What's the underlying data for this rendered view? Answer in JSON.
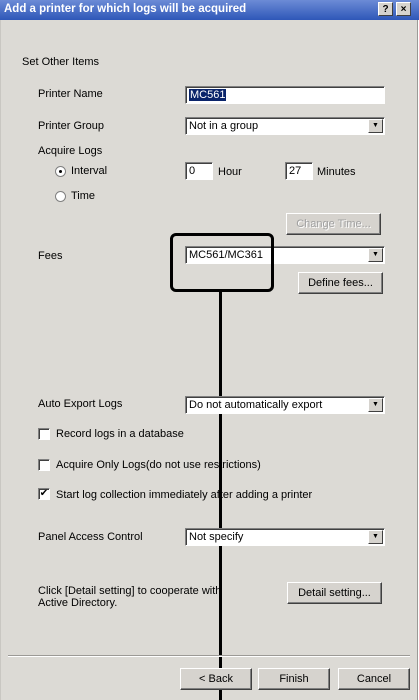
{
  "window": {
    "title": "Add a printer for which logs will be acquired",
    "help_label": "?",
    "close_label": "×"
  },
  "section_title": "Set Other Items",
  "printer_name": {
    "label": "Printer Name",
    "value": "MC561"
  },
  "printer_group": {
    "label": "Printer Group",
    "value": "Not in a group"
  },
  "acquire_logs": {
    "label": "Acquire Logs",
    "interval_label": "Interval",
    "time_label": "Time",
    "selected": "Interval",
    "hour_value": "0",
    "hour_label": "Hour",
    "minutes_value": "27",
    "minutes_label": "Minutes",
    "change_time_label": "Change Time..."
  },
  "fees": {
    "label": "Fees",
    "value": "MC561/MC361",
    "define_label": "Define fees..."
  },
  "auto_export": {
    "label": "Auto Export Logs",
    "value": "Do not automatically export"
  },
  "checkboxes": [
    {
      "label": "Record logs in a database",
      "checked": false
    },
    {
      "label": "Acquire Only Logs(do not use restrictions)",
      "checked": false
    },
    {
      "label": "Start log collection immediately after adding a printer",
      "checked": true
    }
  ],
  "panel_access": {
    "label": "Panel Access Control",
    "value": "Not specify"
  },
  "detail": {
    "text_line1": "Click [Detail setting] to cooperate with",
    "text_line2": "Active Directory.",
    "button_label": "Detail setting..."
  },
  "footer": {
    "back_label": "< Back",
    "finish_label": "Finish",
    "cancel_label": "Cancel"
  },
  "glyphs": {
    "dropdown": "▼",
    "check": "✔"
  }
}
